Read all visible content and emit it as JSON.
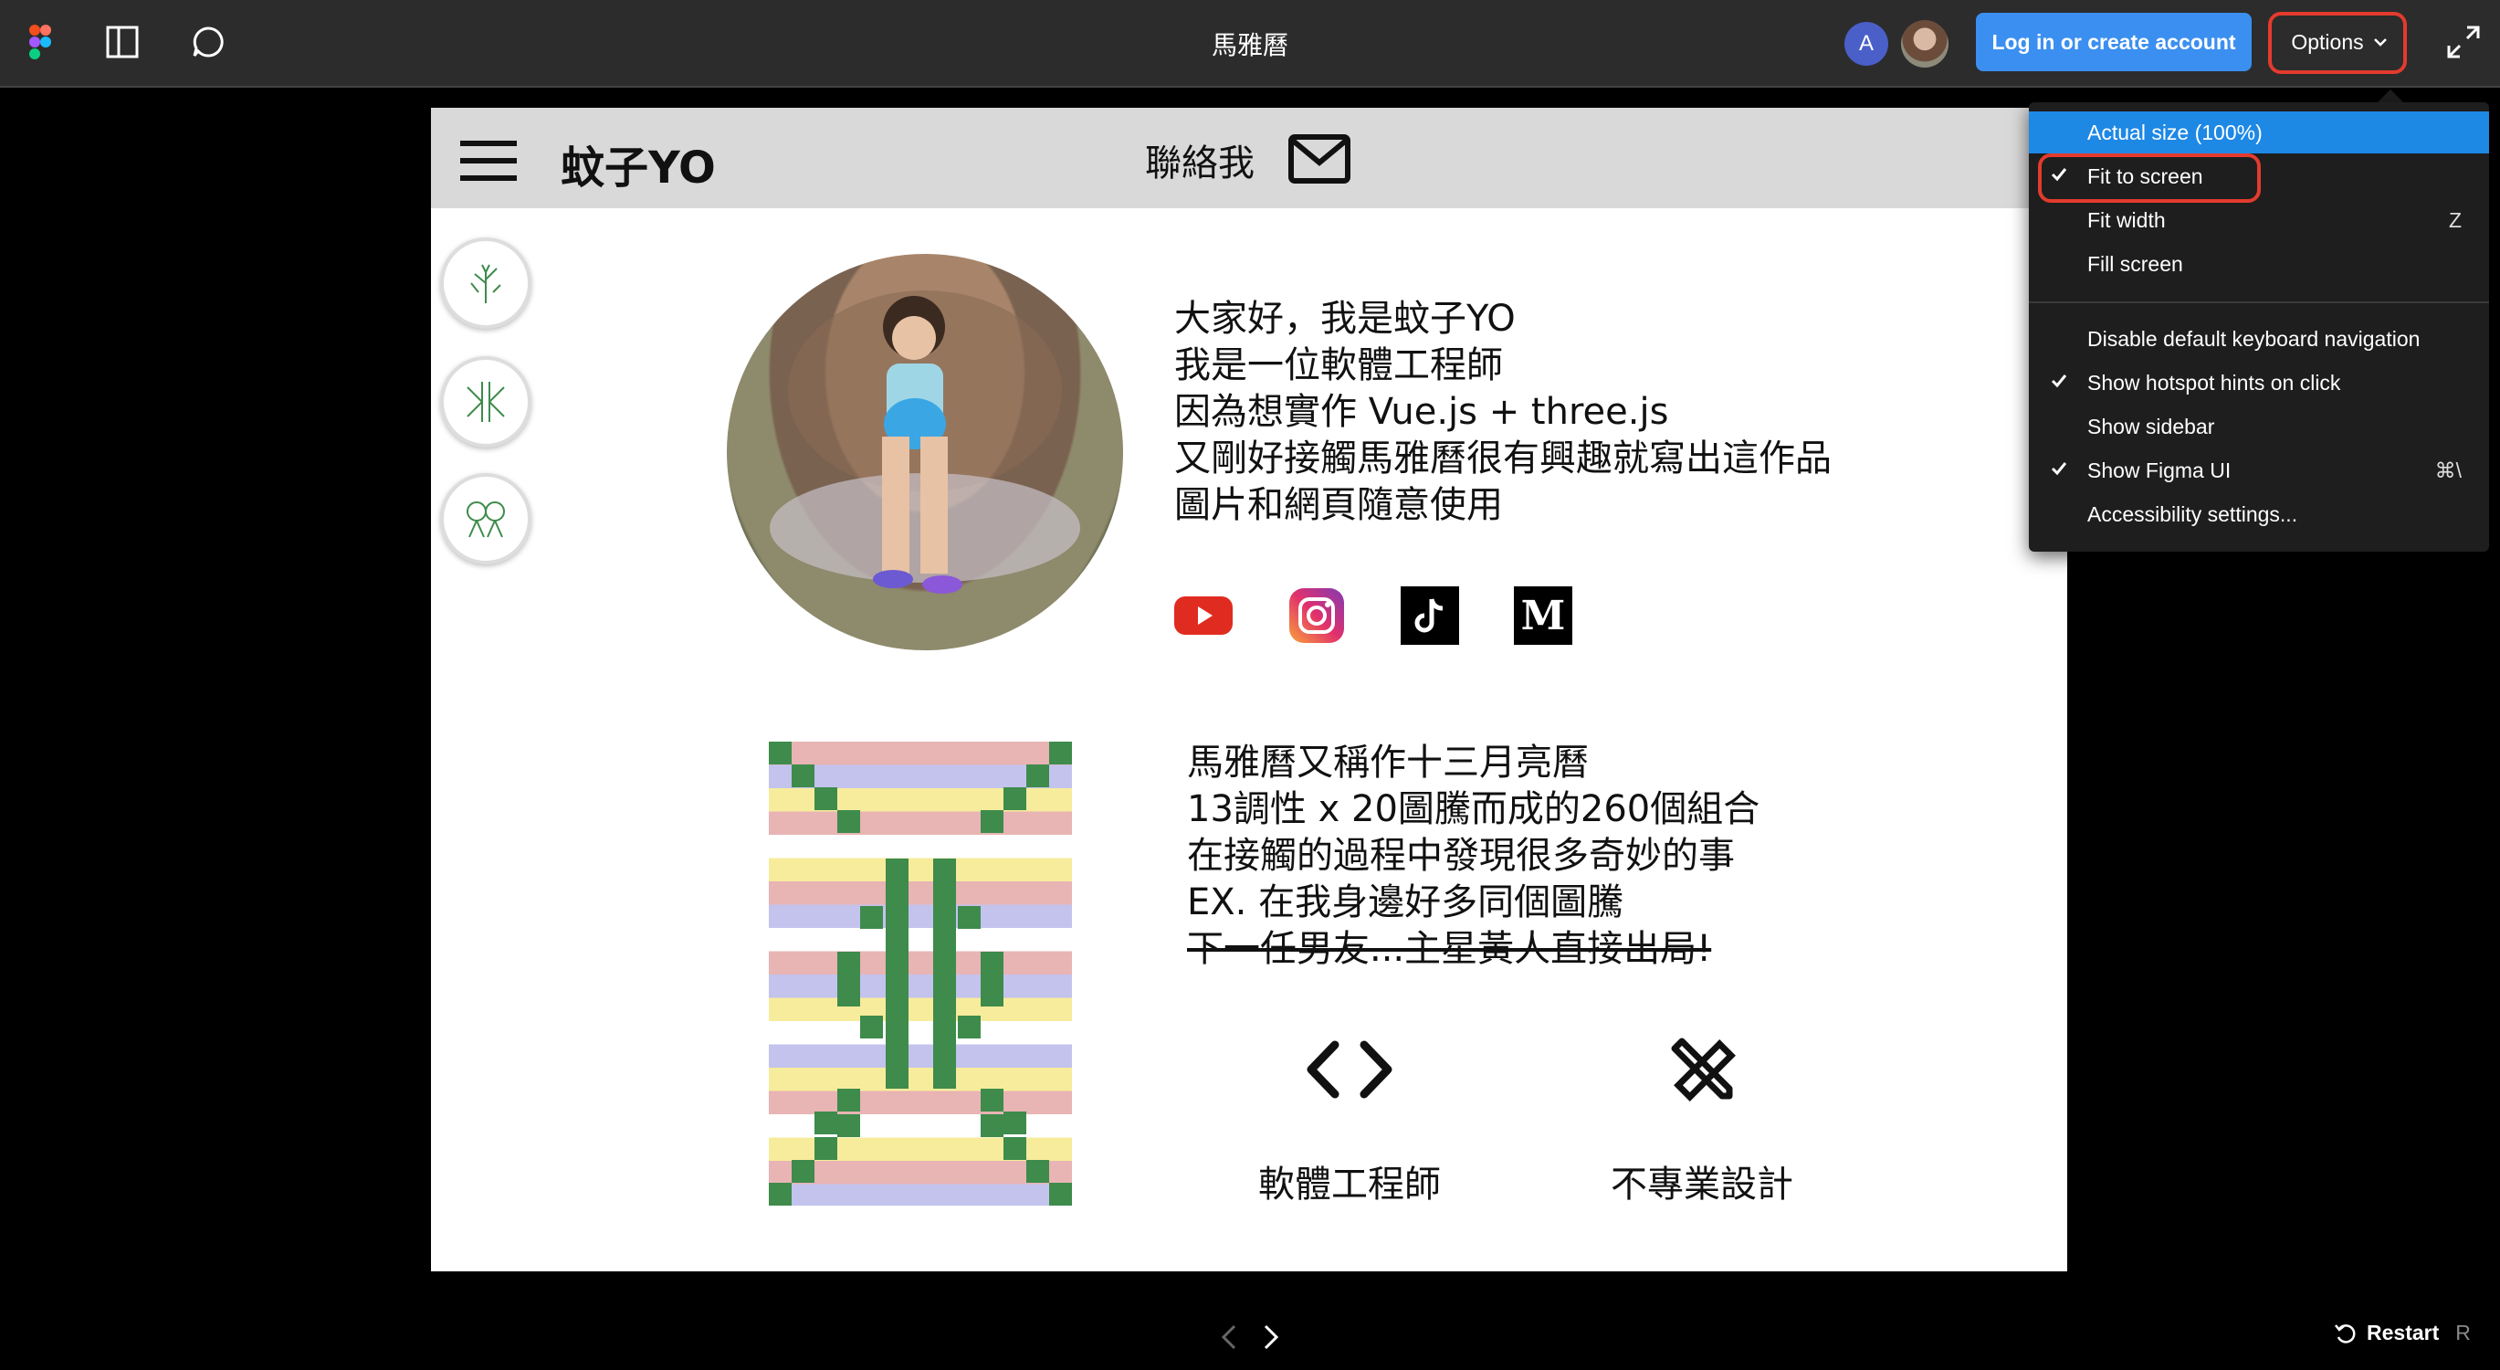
{
  "topbar": {
    "doc_title": "馬雅曆",
    "avatar_letter": "A",
    "login_label": "Log in or create account",
    "options_label": "Options"
  },
  "frame": {
    "brand": "蚊子YO",
    "contact": "聯絡我",
    "bio_lines": [
      "大家好，我是蚊子YO",
      "我是一位軟體工程師",
      "因為想實作 Vue.js + three.js",
      "又剛好接觸馬雅曆很有興趣就寫出這作品",
      "圖片和網頁隨意使用"
    ],
    "about_lines": [
      "馬雅曆又稱作十三月亮曆",
      "13調性 x 20圖騰而成的260個組合",
      "在接觸的過程中發現很多奇妙的事",
      "EX. 在我身邊好多同個圖騰",
      "下一任男友...主星黃人直接出局!"
    ],
    "roles": [
      "軟體工程師",
      "不專業設計"
    ]
  },
  "menu": {
    "items": [
      {
        "label": "Actual size (100%)",
        "shortcut": "",
        "checked": false,
        "active": true
      },
      {
        "label": "Fit to screen",
        "shortcut": "",
        "checked": true,
        "active": false
      },
      {
        "label": "Fit width",
        "shortcut": "Z",
        "checked": false,
        "active": false
      },
      {
        "label": "Fill screen",
        "shortcut": "",
        "checked": false,
        "active": false
      },
      {
        "label": "Disable default keyboard navigation",
        "shortcut": "",
        "checked": false,
        "active": false
      },
      {
        "label": "Show hotspot hints on click",
        "shortcut": "",
        "checked": true,
        "active": false
      },
      {
        "label": "Show sidebar",
        "shortcut": "",
        "checked": false,
        "active": false
      },
      {
        "label": "Show Figma UI",
        "shortcut": "⌘\\",
        "checked": true,
        "active": false
      },
      {
        "label": "Accessibility settings...",
        "shortcut": "",
        "checked": false,
        "active": false
      }
    ]
  },
  "footer": {
    "restart_label": "Restart",
    "restart_key": "R"
  },
  "colors": {
    "topbar_bg": "#2c2c2c",
    "login_blue": "#3b8ff0",
    "highlight_red": "#e33b2e",
    "menu_active": "#1e88e5",
    "pattern_green": "#3e8b4c",
    "pattern_pink": "#e8b4b4",
    "pattern_lavender": "#c3c3ee",
    "pattern_yellow": "#f7ec9c"
  }
}
